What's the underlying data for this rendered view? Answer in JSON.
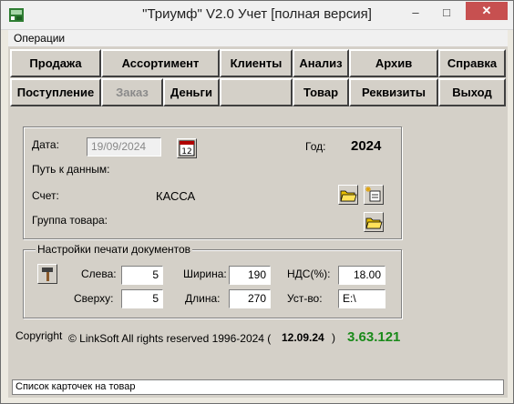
{
  "window": {
    "title": "\"Триумф\" V2.0 Учет [полная версия]",
    "minimize": "–",
    "maximize": "□",
    "close": "✕"
  },
  "menu": {
    "operations": "Операции"
  },
  "toolbar": {
    "row1": [
      "Продажа",
      "Ассортимент",
      "Клиенты",
      "Анализ",
      "Архив",
      "Справка"
    ],
    "row2": [
      "Поступление",
      "Заказ",
      "Деньги",
      "Товар",
      "Реквизиты",
      "Выход"
    ]
  },
  "info": {
    "date_label": "Дата:",
    "date_value": "19/09/2024",
    "year_label": "Год:",
    "year_value": "2024",
    "path_label": "Путь к данным:",
    "account_label": "Счет:",
    "account_value": "КАССА",
    "group_label": "Группа товара:"
  },
  "print": {
    "legend": "Настройки печати документов",
    "left_label": "Слева:",
    "left_value": "5",
    "top_label": "Сверху:",
    "top_value": "5",
    "width_label": "Ширина:",
    "width_value": "190",
    "length_label": "Длина:",
    "length_value": "270",
    "vat_label": "НДС(%):",
    "vat_value": "18.00",
    "device_label": "Уст-во:",
    "device_value": "E:\\"
  },
  "footer": {
    "copyright": "Copyright",
    "rights": "© LinkSoft All rights reserved 1996-2024 (",
    "build_date": "12.09.24",
    "close_paren": ")",
    "version": "3.63.121"
  },
  "status": {
    "text": "Список карточек на товар"
  },
  "colors": {
    "version": "#1a8a1a",
    "close": "#c75050"
  }
}
